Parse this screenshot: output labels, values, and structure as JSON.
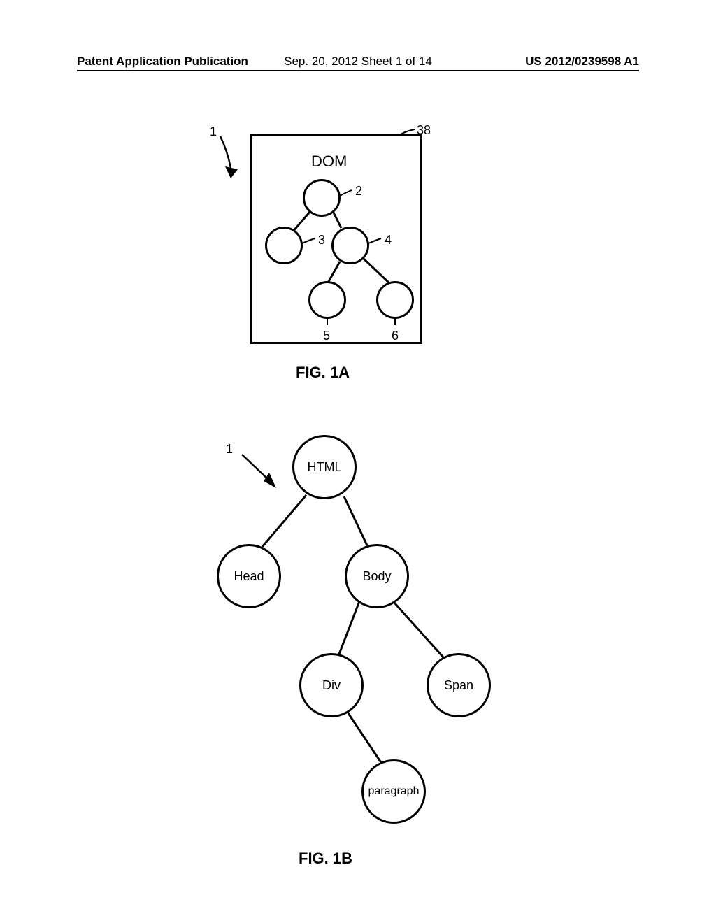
{
  "header": {
    "left": "Patent Application Publication",
    "center": "Sep. 20, 2012  Sheet 1 of 14",
    "right": "US 2012/0239598 A1"
  },
  "figA": {
    "caption": "FIG. 1A",
    "box_title": "DOM",
    "labels": {
      "ref_1": "1",
      "ref_38": "38",
      "node_2": "2",
      "node_3": "3",
      "node_4": "4",
      "node_5": "5",
      "node_6": "6"
    }
  },
  "figB": {
    "caption": "FIG. 1B",
    "ref_1": "1",
    "nodes": {
      "html": "HTML",
      "head": "Head",
      "body": "Body",
      "div": "Div",
      "span": "Span",
      "paragraph": "paragraph"
    }
  }
}
